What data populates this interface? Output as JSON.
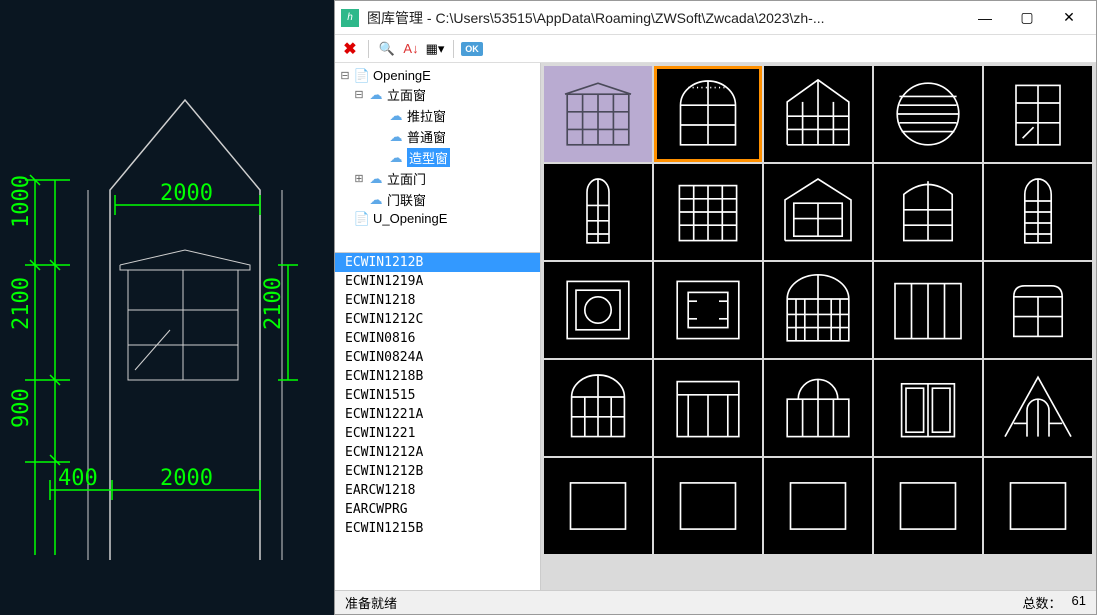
{
  "window": {
    "title": "图库管理 - C:\\Users\\53515\\AppData\\Roaming\\ZWSoft\\Zwcada\\2023\\zh-..."
  },
  "toolbar": {
    "ok_label": "OK"
  },
  "tree": {
    "items": [
      {
        "label": "OpeningE",
        "level": 0,
        "icon": "page",
        "expander": "⊟"
      },
      {
        "label": "立面窗",
        "level": 1,
        "icon": "cloud",
        "expander": "⊟"
      },
      {
        "label": "推拉窗",
        "level": 2,
        "icon": "cloud",
        "expander": ""
      },
      {
        "label": "普通窗",
        "level": 2,
        "icon": "cloud",
        "expander": ""
      },
      {
        "label": "造型窗",
        "level": 2,
        "icon": "cloud",
        "expander": "",
        "selected": true
      },
      {
        "label": "立面门",
        "level": 1,
        "icon": "cloud",
        "expander": "⊞"
      },
      {
        "label": "门联窗",
        "level": 1,
        "icon": "cloud",
        "expander": ""
      },
      {
        "label": "U_OpeningE",
        "level": 0,
        "icon": "page",
        "expander": ""
      }
    ]
  },
  "list": {
    "items": [
      "ECWIN1212B",
      "ECWIN1219A",
      "ECWIN1218",
      "ECWIN1212C",
      "ECWIN0816",
      "ECWIN0824A",
      "ECWIN1218B",
      "ECWIN1515",
      "ECWIN1221A",
      "ECWIN1221",
      "ECWIN1212A",
      "ECWIN1212B",
      "EARCW1218",
      "EARCWPRG",
      "ECWIN1215B"
    ],
    "selected_index": 0
  },
  "statusbar": {
    "status": "准备就绪",
    "total_label": "总数：",
    "total_value": "61"
  },
  "cad": {
    "dims": {
      "d1000": "1000",
      "d2100a": "2100",
      "d2100b": "2100",
      "d900": "900",
      "d400": "400",
      "d2000a": "2000",
      "d2000b": "2000"
    }
  }
}
